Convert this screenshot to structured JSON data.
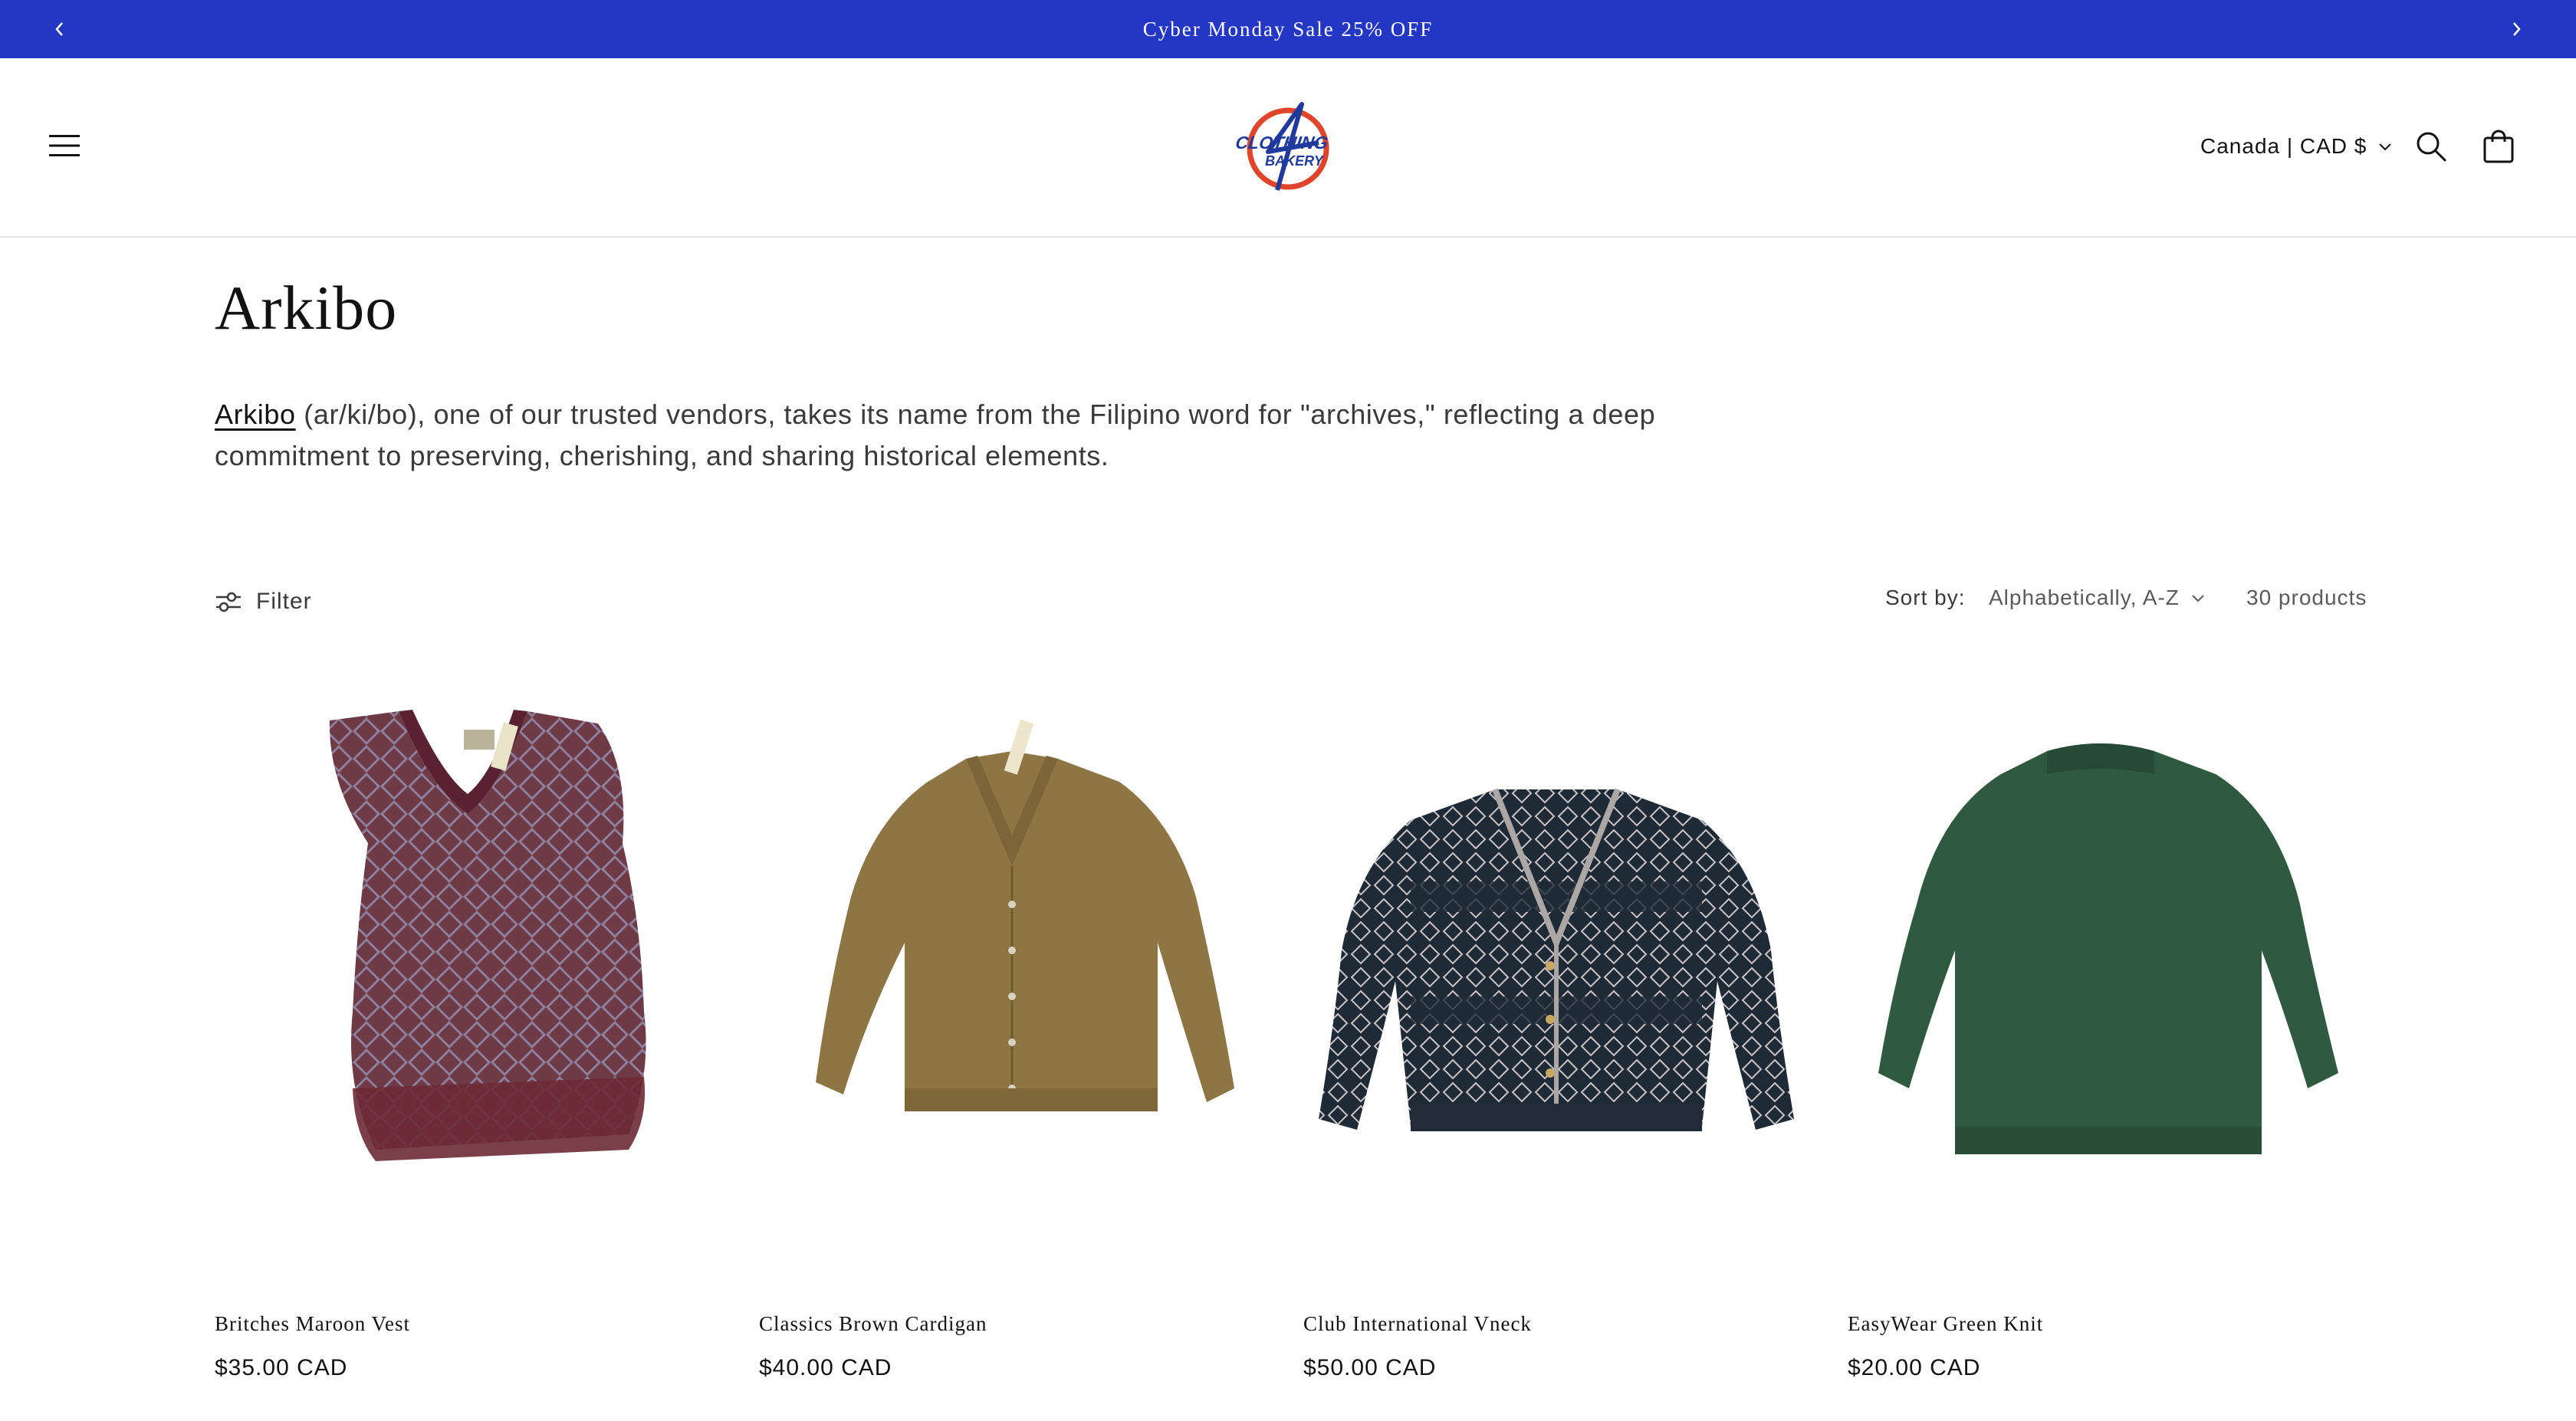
{
  "announcement": {
    "text": "Cyber Monday Sale 25% OFF",
    "background": "#2336c4"
  },
  "header": {
    "menu_icon": "hamburger-icon",
    "logo_text": "CLOTHING BAKERY",
    "country_selector": "Canada | CAD $",
    "search_icon": "search-icon",
    "cart_icon": "cart-icon"
  },
  "collection": {
    "title": "Arkibo",
    "description_link": "Arkibo",
    "description_rest": " (ar/ki/bo), one of our trusted vendors, takes its name from the Filipino word for \"archives,\" reflecting a deep commitment to preserving, cherishing, and sharing historical elements."
  },
  "toolbar": {
    "filter_label": "Filter",
    "sort_label": "Sort by:",
    "sort_value": "Alphabetically, A-Z",
    "product_count": "30 products"
  },
  "products": [
    {
      "name": "Britches Maroon Vest",
      "price": "$35.00 CAD",
      "color": "#6e3a44"
    },
    {
      "name": "Classics Brown Cardigan",
      "price": "$40.00 CAD",
      "color": "#8e7544"
    },
    {
      "name": "Club International Vneck",
      "price": "$50.00 CAD",
      "color": "#1e2a36"
    },
    {
      "name": "EasyWear Green Knit",
      "price": "$20.00 CAD",
      "color": "#2f5a40"
    }
  ]
}
